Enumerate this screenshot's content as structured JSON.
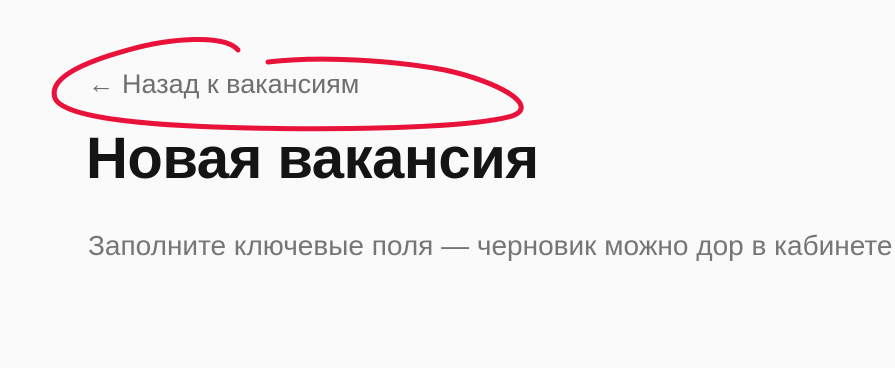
{
  "nav": {
    "back_arrow_icon": "left-arrow-icon",
    "back_arrow_glyph": "←",
    "back_label": "Назад к вакансиям"
  },
  "header": {
    "title": "Новая вакансия",
    "subtitle": "Заполните ключевые поля — черновик можно дор в кабинете."
  },
  "colors": {
    "background": "#fafafa",
    "title": "#141414",
    "muted_text": "#767678",
    "annotation": "#e8123a"
  }
}
